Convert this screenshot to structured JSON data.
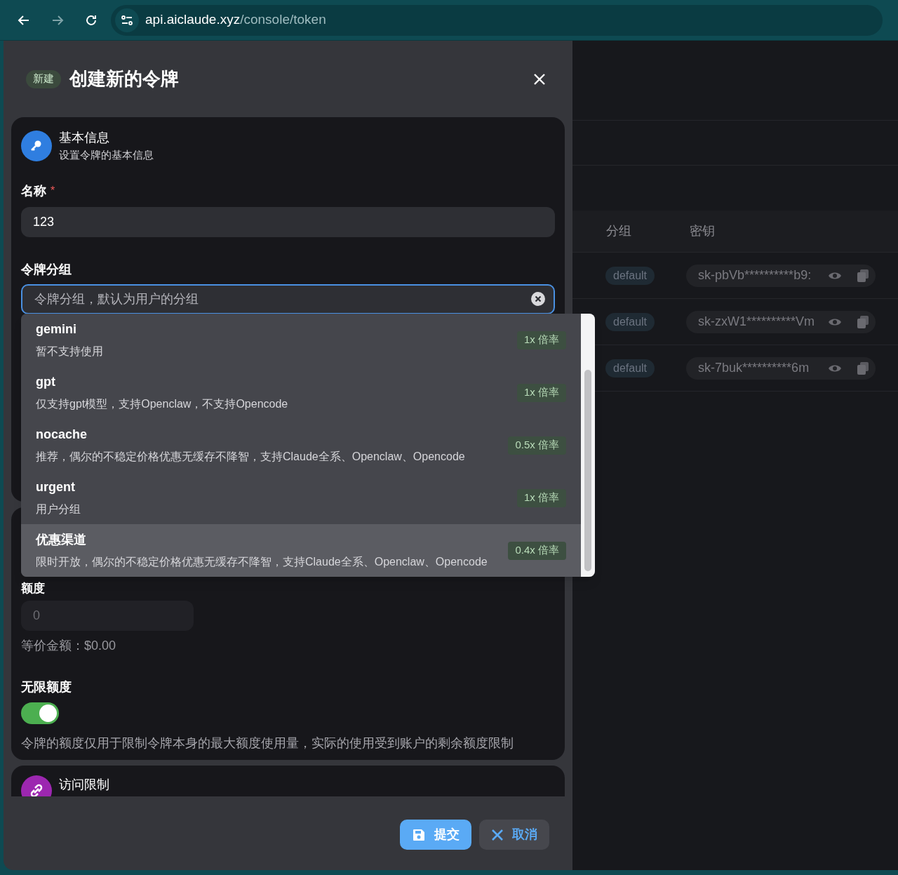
{
  "browser": {
    "url_host": "api.aiclaude.xyz",
    "url_path": "/console/token"
  },
  "dialog": {
    "badge": "新建",
    "title": "创建新的令牌",
    "basic_section": {
      "title": "基本信息",
      "subtitle": "设置令牌的基本信息",
      "name_field": {
        "label": "名称",
        "required_mark": "*",
        "value": "123"
      },
      "group_field": {
        "label": "令牌分组",
        "placeholder": "令牌分组，默认为用户的分组",
        "focused": true
      }
    },
    "group_options": [
      {
        "name": "gemini",
        "description": "暂不支持使用",
        "ratio": "1x 倍率",
        "highlighted": false
      },
      {
        "name": "gpt",
        "description": "仅支持gpt模型，支持Openclaw，不支持Opencode",
        "ratio": "1x 倍率",
        "highlighted": false
      },
      {
        "name": "nocache",
        "description": "推荐，偶尔的不稳定价格优惠无缓存不降智，支持Claude全系、Openclaw、Opencode",
        "ratio": "0.5x 倍率",
        "highlighted": false
      },
      {
        "name": "urgent",
        "description": "用户分组",
        "ratio": "1x 倍率",
        "highlighted": false
      },
      {
        "name": "优惠渠道",
        "description": "限时开放，偶尔的不稳定价格优惠无缓存不降智，支持Claude全系、Openclaw、Opencode",
        "ratio": "0.4x 倍率",
        "highlighted": true
      }
    ],
    "quota_section": {
      "quota_label": "额度",
      "quota_placeholder": "0",
      "equivalent": "等价金额：$0.00",
      "unlimited_label": "无限额度",
      "unlimited_on": true,
      "hint": "令牌的额度仅用于限制令牌本身的最大额度使用量，实际的使用受到账户的剩余额度限制"
    },
    "access_section": {
      "title": "访问限制"
    },
    "buttons": [
      {
        "label": "提交",
        "kind": "primary"
      },
      {
        "label": "取消",
        "kind": "secondary"
      }
    ]
  },
  "token_table": {
    "columns": [
      "分组",
      "密钥"
    ],
    "rows": [
      {
        "group": "default",
        "key": "sk-pbVb**********b9:"
      },
      {
        "group": "default",
        "key": "sk-zxW1**********Vm"
      },
      {
        "group": "default",
        "key": "sk-7buk**********6m"
      }
    ]
  }
}
